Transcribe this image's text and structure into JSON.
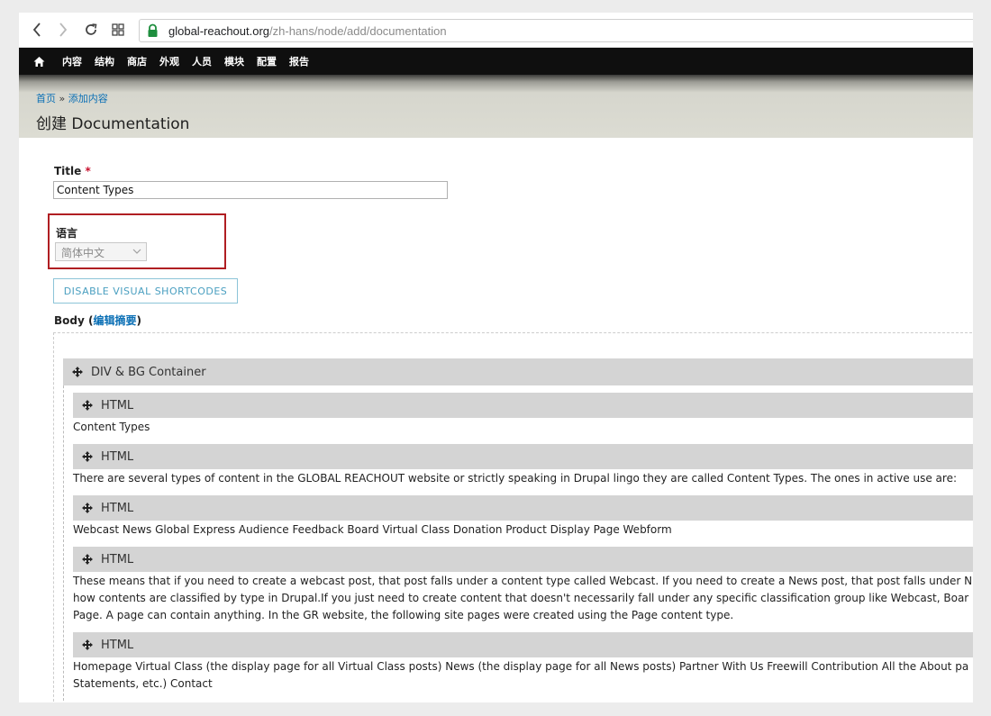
{
  "browser": {
    "url_domain": "global-reachout.org",
    "url_path": "/zh-hans/node/add/documentation",
    "back_icon": "chevron-left-icon",
    "forward_icon": "chevron-right-icon",
    "reload_icon": "reload-icon",
    "apps_icon": "apps-grid-icon",
    "lock_icon": "lock-icon"
  },
  "toolbar": {
    "home_icon": "home-icon",
    "items": [
      "内容",
      "结构",
      "商店",
      "外观",
      "人员",
      "模块",
      "配置",
      "报告"
    ]
  },
  "header": {
    "breadcrumb_home": "首页",
    "breadcrumb_sep": " » ",
    "breadcrumb_current": "添加内容",
    "title": "创建 Documentation"
  },
  "form": {
    "title_label": "Title",
    "required_mark": "*",
    "title_value": "Content Types",
    "language_label": "语言",
    "language_value": "简体中文",
    "shortcode_button": "DISABLE VISUAL SHORTCODES",
    "body_label": "Body",
    "body_paren_open": " (",
    "edit_summary": "编辑摘要",
    "body_paren_close": ")"
  },
  "editor": {
    "container_title": "DIV & BG Container",
    "blocks": [
      {
        "type": "HTML",
        "lines": [
          "Content Types"
        ]
      },
      {
        "type": "HTML",
        "lines": [
          "There are several types of content in the GLOBAL REACHOUT website or strictly speaking in Drupal lingo they are called Content Types. The ones in active use are:"
        ]
      },
      {
        "type": "HTML",
        "lines": [
          "Webcast News Global Express Audience Feedback Board Virtual Class Donation Product Display Page Webform"
        ]
      },
      {
        "type": "HTML",
        "lines": [
          "These means that if you need to create a webcast post, that post falls under a content type called Webcast. If you need to create a News post, that post falls under N",
          "how contents are classified by type in Drupal.If you just need to create content that doesn't necessarily fall under any specific classification group like Webcast, Boar",
          "Page. A page can contain anything. In the GR website, the following site pages were created using the Page content type."
        ]
      },
      {
        "type": "HTML",
        "lines": [
          "Homepage Virtual Class (the display page for all Virtual Class posts) News (the display page for all News posts) Partner With Us Freewill Contribution All the About pa",
          "Statements, etc.) Contact"
        ]
      }
    ],
    "drag_icon": "move-handle-icon"
  }
}
